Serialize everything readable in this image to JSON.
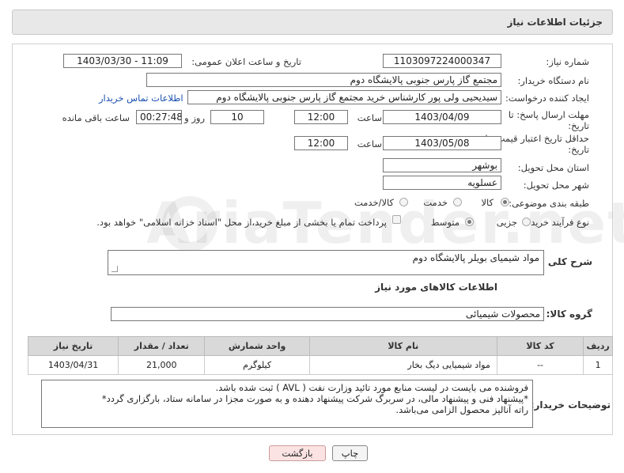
{
  "header": {
    "title": "جزئیات اطلاعات نیاز"
  },
  "fields": {
    "need_number": {
      "label": "شماره نیاز:",
      "value": "1103097224000347"
    },
    "announce_datetime": {
      "label": "تاریخ و ساعت اعلان عمومی:",
      "value": "1403/03/30 - 11:09"
    },
    "buyer_org": {
      "label": "نام دستگاه خریدار:",
      "value": "مجتمع گاز پارس جنوبی  پالایشگاه دوم"
    },
    "requester": {
      "label": "ایجاد کننده درخواست:",
      "value": "سیدیحیی ولی پور کارشناس خرید مجتمع گاز پارس جنوبی  پالایشگاه دوم"
    },
    "buyer_contact_link": "اطلاعات تماس خریدار",
    "reply_deadline": {
      "label_line1": "مهلت ارسال پاسخ: تا",
      "label_line2": "تاریخ:",
      "date": "1403/04/09",
      "time_label": "ساعت",
      "time": "12:00",
      "days": "10",
      "days_label": "روز و",
      "remaining_time": "00:27:48",
      "remaining_label": "ساعت باقی مانده"
    },
    "price_validity": {
      "label_line1": "حداقل تاریخ اعتبار قیمت: تا",
      "label_line2": "تاریخ:",
      "date": "1403/05/08",
      "time_label": "ساعت",
      "time": "12:00"
    },
    "delivery_province": {
      "label": "استان محل تحویل:",
      "value": "بوشهر"
    },
    "delivery_city": {
      "label": "شهر محل تحویل:",
      "value": "عسلویه"
    },
    "category": {
      "label": "طبقه بندی موضوعی:",
      "options": [
        "کالا",
        "خدمت",
        "کالا/خدمت"
      ],
      "selected": "کالا"
    },
    "purchase_type": {
      "label": "نوع فرآیند خرید :",
      "options": [
        "جزیی",
        "متوسط"
      ],
      "selected": "متوسط",
      "treasury_note": "پرداخت تمام یا بخشی از مبلغ خرید،از محل \"اسناد خزانه اسلامی\" خواهد بود."
    }
  },
  "description": {
    "label": "شرح کلی نیاز:",
    "value": "مواد شیمیای بویلر پالایشگاه دوم"
  },
  "goods_section_title": "اطلاعات کالاهای مورد نیاز",
  "goods_group": {
    "label": "گروه کالا:",
    "value": "محصولات شیمیائی"
  },
  "table": {
    "headers": [
      "ردیف",
      "کد کالا",
      "نام کالا",
      "واحد شمارش",
      "تعداد / مقدار",
      "تاریخ نیاز"
    ],
    "rows": [
      [
        "1",
        "--",
        "مواد شیمیایی دیگ بخار",
        "کیلوگرم",
        "21,000",
        "1403/04/31"
      ]
    ]
  },
  "buyer_notes": {
    "label": "توضیحات خریدار:",
    "lines": [
      "فروشنده می بایست در لیست منابع مورد تائید وزارت نفت ( AVL ) ثبت شده باشد.",
      "*پیشنهاد فنی و پیشنهاد مالی، در سربرگ شرکت پیشنهاد دهنده و به صورت مجزا در سامانه ستاد، بارگزاری گردد*",
      "راته آنالیز محصول الزامی می‌باشد."
    ]
  },
  "buttons": {
    "print": "چاپ",
    "back": "بازگشت"
  },
  "watermark": "AriaTender.net"
}
